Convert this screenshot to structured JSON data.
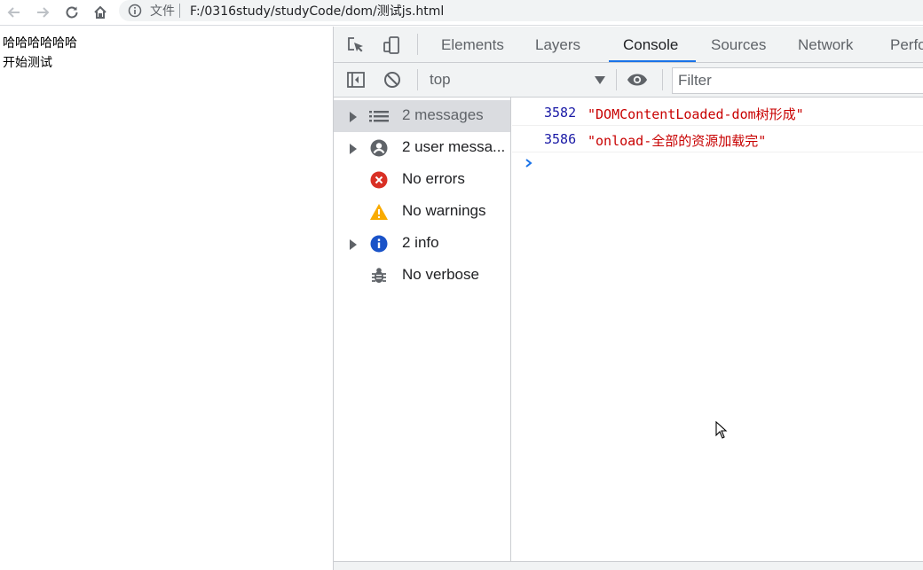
{
  "browser": {
    "omnibox_label": "文件",
    "url": "F:/0316study/studyCode/dom/测试js.html"
  },
  "page": {
    "lines": [
      "哈哈哈哈哈哈",
      "开始测试"
    ]
  },
  "devtools": {
    "tabs": [
      "Elements",
      "Layers",
      "Console",
      "Sources",
      "Network",
      "Perfo"
    ],
    "active_tab": "Console",
    "context": "top",
    "filter_placeholder": "Filter",
    "sidebar": [
      {
        "label": "2 messages",
        "icon": "list-icon",
        "expandable": true,
        "selected": true
      },
      {
        "label": "2 user messa...",
        "icon": "user-icon",
        "expandable": true,
        "selected": false
      },
      {
        "label": "No errors",
        "icon": "error-icon",
        "expandable": false,
        "selected": false
      },
      {
        "label": "No warnings",
        "icon": "warning-icon",
        "expandable": false,
        "selected": false
      },
      {
        "label": "2 info",
        "icon": "info-icon",
        "expandable": true,
        "selected": false
      },
      {
        "label": "No verbose",
        "icon": "bug-icon",
        "expandable": false,
        "selected": false
      }
    ],
    "messages": [
      {
        "num": "3582",
        "text": "\"DOMContentLoaded-dom树形成\""
      },
      {
        "num": "3586",
        "text": "\"onload-全部的资源加载完\""
      }
    ],
    "colors": {
      "accent": "#1a73e8",
      "string": "#c80000",
      "number": "#1a1aa6",
      "error": "#d93025",
      "warning": "#f9ab00",
      "info": "#1a73e8"
    }
  }
}
